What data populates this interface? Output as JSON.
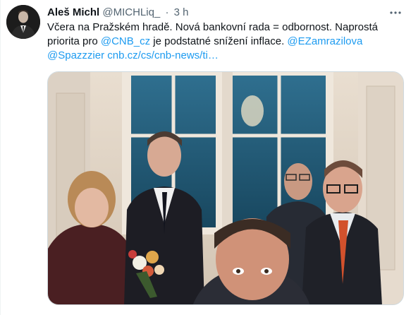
{
  "tweet": {
    "author_name": "Aleš Michl",
    "author_handle": "@MICHLiq_",
    "separator": "·",
    "time": "3 h",
    "more_icon": "ellipsis-icon",
    "text_plain_1": "Včera na Pražském hradě. Nová bankovní rada = odbornost. Naprostá priorita pro ",
    "mention_cnb": "@CNB_cz",
    "text_plain_2": " je podstatné snížení inflace. ",
    "mention_ez": "@EZamrazilova",
    "mention_spaz": "@Spazzzier",
    "link_url": "cnb.cz/cs/cnb-news/ti…",
    "colors": {
      "link": "#1d9bf0",
      "secondary": "#536471",
      "primary_text": "#0f1419"
    }
  }
}
